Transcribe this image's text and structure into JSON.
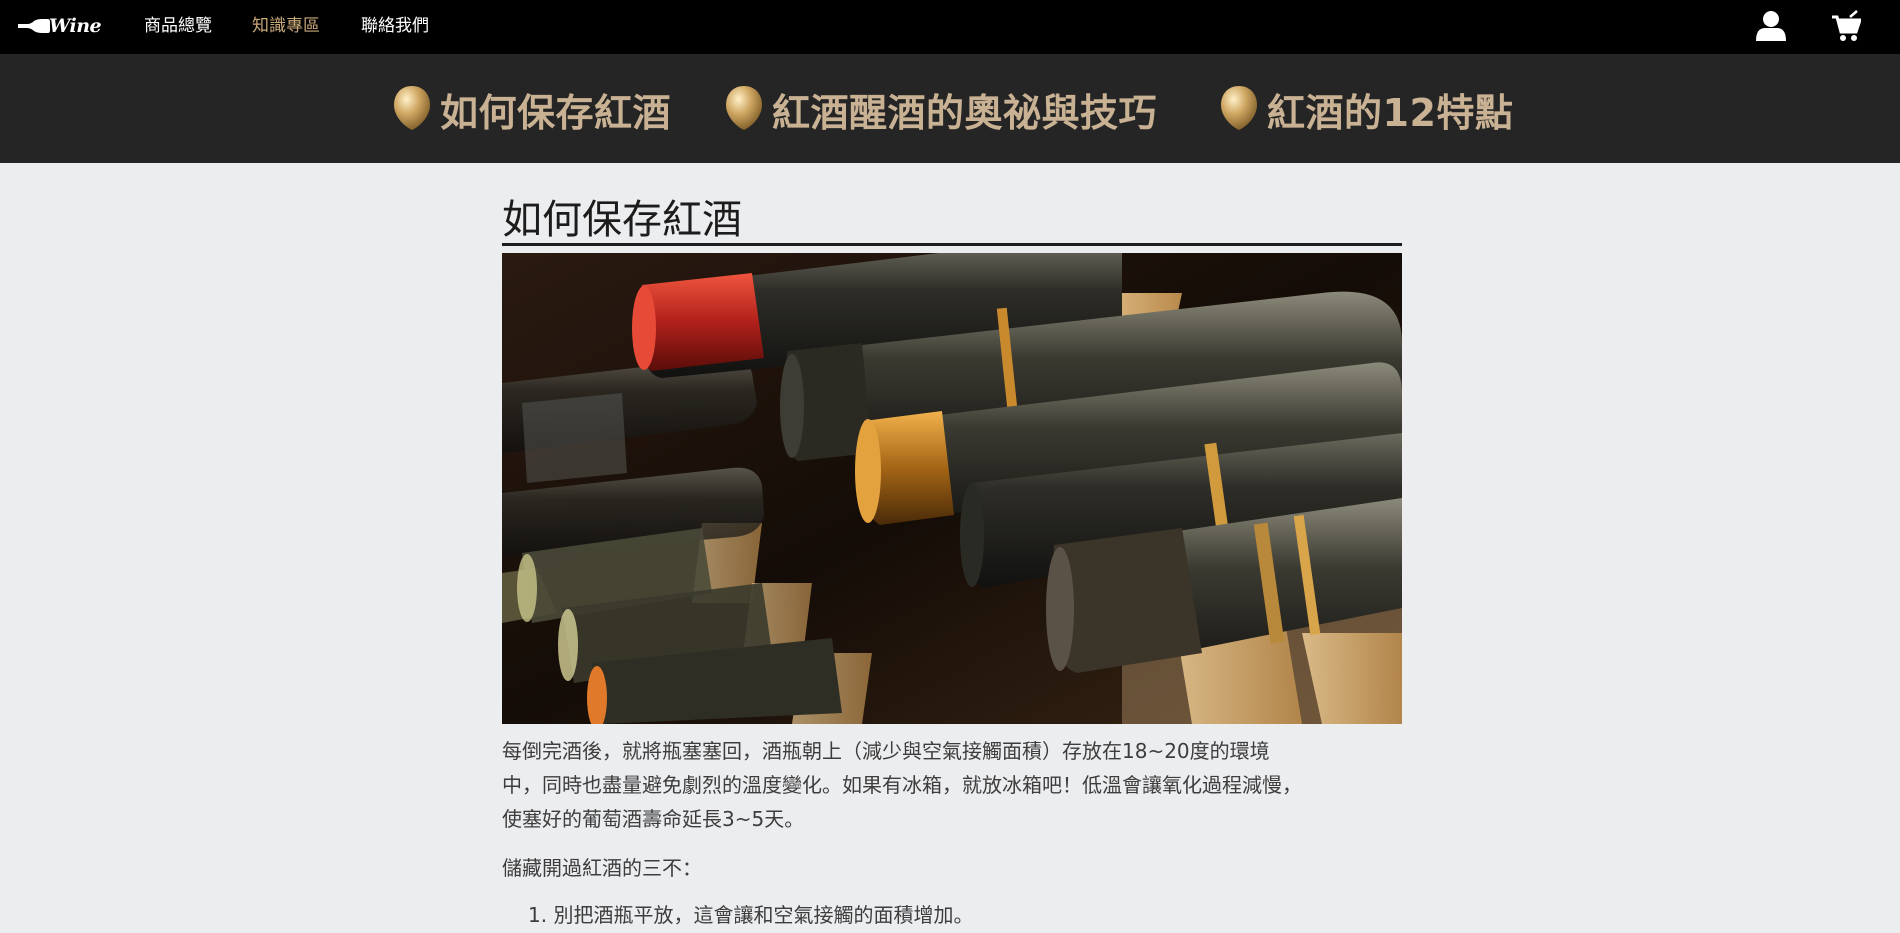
{
  "navbar": {
    "brand": "Wine",
    "links": [
      {
        "label": "商品總覽",
        "active": false
      },
      {
        "label": "知識專區",
        "active": true
      },
      {
        "label": "聯絡我們",
        "active": false
      }
    ],
    "icons": [
      "user-icon",
      "cart-icon"
    ],
    "active_color": "#c9a878"
  },
  "topics": [
    {
      "label": "如何保存紅酒",
      "icon": "balloon-icon"
    },
    {
      "label": "紅酒醒酒的奧祕與技巧",
      "icon": "balloon-icon"
    },
    {
      "label": "紅酒的12特點",
      "icon": "balloon-icon"
    }
  ],
  "article": {
    "title": "如何保存紅酒",
    "image": "wine-bottles-rack-photo",
    "paragraph_lines": [
      "每倒完酒後，就將瓶塞塞回，酒瓶朝上（減少與空氣接觸面積）存放在18~20度的環境",
      "中，同時也盡量避免劇烈的溫度變化。如果有冰箱，就放冰箱吧！低溫會讓氧化過程減慢，",
      "使塞好的葡萄酒壽命延長3~5天。"
    ],
    "subheading": "儲藏開過紅酒的三不：",
    "list": [
      "1. 別把酒瓶平放，這會讓和空氣接觸的面積增加。"
    ]
  },
  "colors": {
    "navbar_bg": "#000000",
    "subnav_bg": "#252525",
    "page_bg": "#ecedef",
    "topic_text": "#c9b193"
  }
}
